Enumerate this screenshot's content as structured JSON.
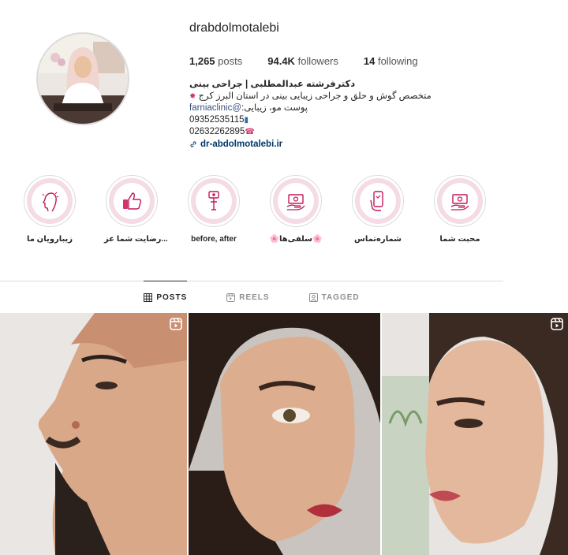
{
  "profile": {
    "username": "drabdolmotalebi",
    "stats": {
      "posts_count": "1,265",
      "posts_label": "posts",
      "followers_count": "94.4K",
      "followers_label": "followers",
      "following_count": "14",
      "following_label": "following"
    },
    "bio": {
      "name": "دکترفرشته عبدالمطلبی | جراحی بینی",
      "line1": "متخصص گوش و حلق و جراحی زیبایی بینی در استان البرز کرج",
      "line2": "پوست مو، زیبایی:",
      "mention": "farniaclinic@",
      "phone1": "09352535115",
      "phone2": "02632262895",
      "link": "dr-abdolmotalebi.ir"
    }
  },
  "highlights": [
    {
      "label": "زیبارویان ما",
      "icon": "face-profile-icon"
    },
    {
      "label": "رضایت شما عز...",
      "icon": "thumbs-up-icon"
    },
    {
      "label": "before, after",
      "icon": "selfie-stick-icon"
    },
    {
      "label": "🌸سلفی‌ها🌸",
      "icon": "money-hand-icon"
    },
    {
      "label": "شماره‌تماس",
      "icon": "phone-hand-icon"
    },
    {
      "label": "محبت شما",
      "icon": "money-hand-icon"
    }
  ],
  "tabs": [
    {
      "label": "POSTS",
      "icon": "grid-icon",
      "active": true
    },
    {
      "label": "REELS",
      "icon": "reels-icon",
      "active": false
    },
    {
      "label": "TAGGED",
      "icon": "tagged-icon",
      "active": false
    }
  ],
  "colors": {
    "accent": "#d6336c",
    "link": "#00376b",
    "highlight_ring": "#f4dbe6"
  }
}
